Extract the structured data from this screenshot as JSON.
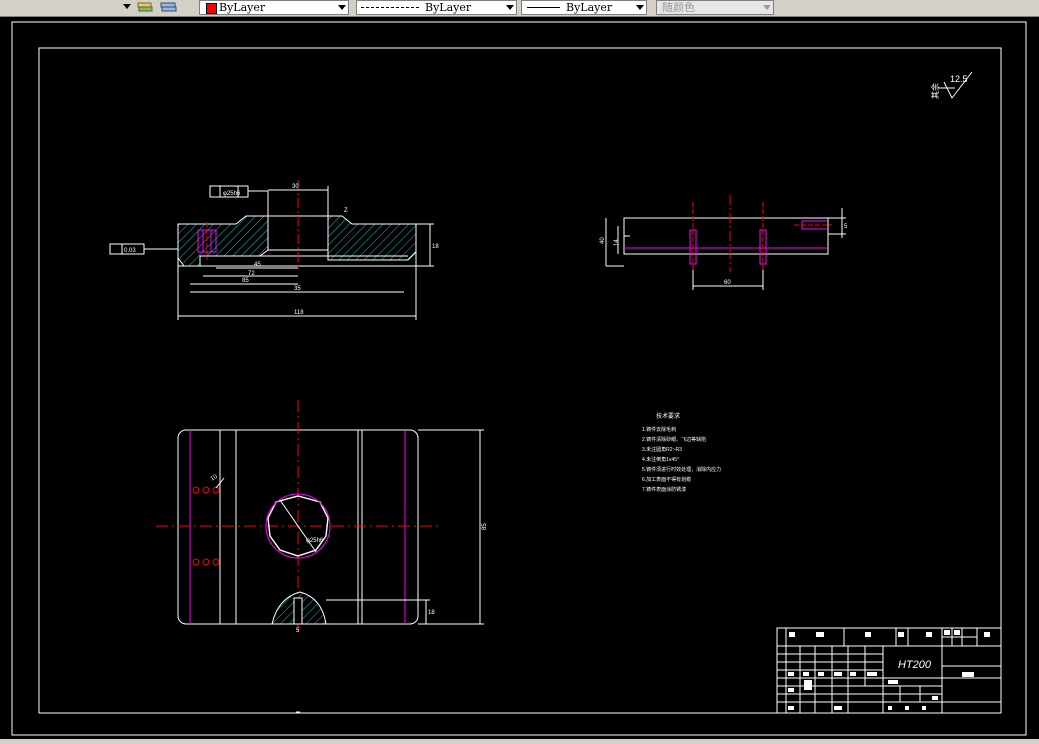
{
  "toolbar": {
    "color_control": "ByLayer",
    "linetype_control": "ByLayer",
    "lineweight_control": "ByLayer",
    "plot_style_control": "随颜色"
  },
  "drawing": {
    "surface_finish": "12.5",
    "surface_finish_note": "其余",
    "material": "HT200",
    "tech_req_title": "技术要求",
    "tech_req_lines": [
      "1.铸件去除毛刺",
      "2.铸件清除砂眼、飞边等缺陷",
      "3.未注圆角R2~R3",
      "4.未注倒角1x45°",
      "5.铸件须进行时效处理，消除内应力",
      "6.加工表面不得有划痕",
      "7.铸件表面涂防锈漆"
    ],
    "dims": {
      "d_25h6": "φ25h6",
      "d_015": "0.03",
      "d_30": "30",
      "d_45": "45",
      "d_72": "72",
      "d_85": "85",
      "d_118": "118",
      "d_40": "40",
      "d_60": "60",
      "d_14": "14",
      "d_5": "5",
      "d_18": "18",
      "d_10": "10",
      "d_z": "Z",
      "d_35": "35"
    }
  }
}
